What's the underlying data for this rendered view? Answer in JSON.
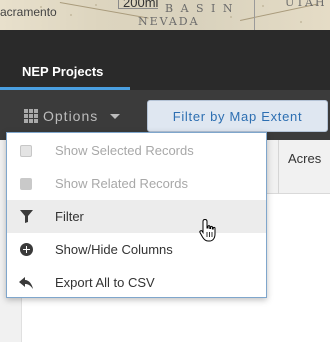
{
  "map": {
    "labels": {
      "city": "acramento",
      "scale": "200mi",
      "basin": "B A S I N",
      "nevada": "NEVADA",
      "utah": "UTAH"
    }
  },
  "tab": {
    "label": "NEP Projects"
  },
  "toolbar": {
    "options_label": "Options",
    "filter_extent_label": "Filter by Map Extent"
  },
  "table": {
    "column_acres": "Acres"
  },
  "menu": {
    "items": [
      {
        "label": "Show Selected Records",
        "icon": "selected-records-icon",
        "enabled": false
      },
      {
        "label": "Show Related Records",
        "icon": "related-records-icon",
        "enabled": false
      },
      {
        "label": "Filter",
        "icon": "filter-icon",
        "enabled": true
      },
      {
        "label": "Show/Hide Columns",
        "icon": "add-circle-icon",
        "enabled": true
      },
      {
        "label": "Export All to CSV",
        "icon": "export-arrow-icon",
        "enabled": true
      }
    ]
  },
  "colors": {
    "tab_indicator": "#4a9fe0",
    "menu_border": "#7fa6cc",
    "filter_button_text": "#2d6fb2"
  }
}
